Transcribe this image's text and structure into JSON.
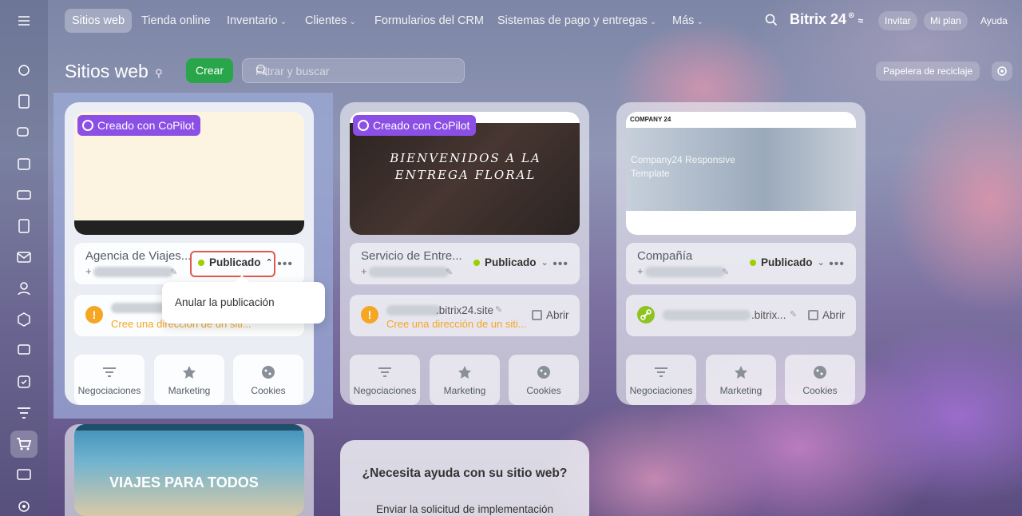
{
  "top_nav": {
    "tabs": [
      {
        "label": "Sitios web",
        "active": true
      },
      {
        "label": "Tienda online"
      },
      {
        "label": "Inventario",
        "dropdown": true
      },
      {
        "label": "Clientes",
        "dropdown": true
      },
      {
        "label": "Formularios del CRM"
      },
      {
        "label": "Sistemas de pago y entregas",
        "dropdown": true
      },
      {
        "label": "Más",
        "dropdown": true
      }
    ],
    "brand": "Bitrix 24",
    "invite": "Invitar",
    "my_plan": "Mi plan",
    "help": "Ayuda"
  },
  "header": {
    "title": "Sitios web",
    "create_button": "Crear",
    "search_placeholder": "Filtrar y buscar",
    "recycle_bin": "Papelera de reciclaje"
  },
  "sites": [
    {
      "badge": "Creado con CoPilot",
      "name": "Agencia de Viajes...",
      "status": "Publicado",
      "warning": "Cree una dirección de un siti...",
      "tiles": [
        "Negociaciones",
        "Marketing",
        "Cookies"
      ]
    },
    {
      "badge": "Creado con CoPilot",
      "name": "Servicio de Entre...",
      "status": "Publicado",
      "domain": ".bitrix24.site",
      "open": "Abrir",
      "warning": "Cree una dirección de un siti...",
      "thumbnail_text": "BIENVENIDOS A LA ENTREGA FLORAL",
      "tiles": [
        "Negociaciones",
        "Marketing",
        "Cookies"
      ]
    },
    {
      "name": "Compañía",
      "status": "Publicado",
      "domain": ".bitrix...",
      "open": "Abrir",
      "thumbnail_brand": "COMPANY 24",
      "thumbnail_text": "Company24 Responsive Template",
      "tiles": [
        "Negociaciones",
        "Marketing",
        "Cookies"
      ]
    },
    {
      "thumbnail_text": "VIAJES PARA TODOS"
    }
  ],
  "dropdown": {
    "item": "Anular la publicación"
  },
  "help_card": {
    "title": "¿Necesita ayuda con su sitio web?",
    "link": "Enviar la solicitud de implementación"
  },
  "colors": {
    "create": "#2aa64a",
    "copilot": "#8b4fe6",
    "published_dot": "#9dcf00",
    "warning": "#f5a623",
    "highlight_border": "#e05a4f"
  }
}
